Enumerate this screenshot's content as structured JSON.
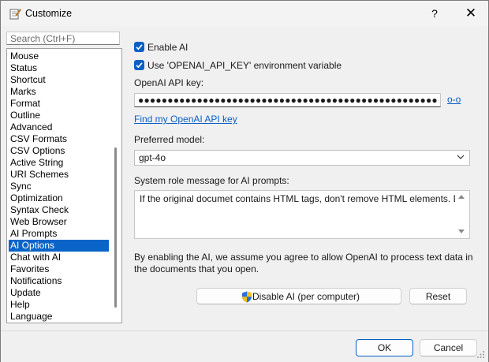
{
  "window": {
    "title": "Customize",
    "help_label": "?",
    "close_label": "✕"
  },
  "sidebar": {
    "search_placeholder": "Search (Ctrl+F)",
    "items": [
      {
        "label": "Mouse"
      },
      {
        "label": "Status"
      },
      {
        "label": "Shortcut"
      },
      {
        "label": "Marks"
      },
      {
        "label": "Format"
      },
      {
        "label": "Outline"
      },
      {
        "label": "Advanced"
      },
      {
        "label": "CSV Formats"
      },
      {
        "label": "CSV Options"
      },
      {
        "label": "Active String"
      },
      {
        "label": "URI Schemes"
      },
      {
        "label": "Sync"
      },
      {
        "label": "Optimization"
      },
      {
        "label": "Syntax Check"
      },
      {
        "label": "Web Browser"
      },
      {
        "label": "AI Prompts"
      },
      {
        "label": "AI Options",
        "selected": true
      },
      {
        "label": "Chat with AI"
      },
      {
        "label": "Favorites"
      },
      {
        "label": "Notifications"
      },
      {
        "label": "Update"
      },
      {
        "label": "Help"
      },
      {
        "label": "Language"
      }
    ]
  },
  "ai_options": {
    "enable_ai_label": "Enable AI",
    "enable_ai_checked": true,
    "use_env_label": "Use 'OPENAI_API_KEY' environment variable",
    "use_env_checked": true,
    "api_key_label": "OpenAI API key:",
    "api_key_value": "●●●●●●●●●●●●●●●●●●●●●●●●●●●●●●●●●●●●●●●●●●●●●●●●●●●",
    "show_key_link": "o-o",
    "find_key_link": "Find my OpenAI API key",
    "model_label": "Preferred model:",
    "model_value": "gpt-4o",
    "system_message_label": "System role message for AI prompts:",
    "system_message_value": "If the original documet contains HTML tags, don't remove HTML elements. Do",
    "consent_note": "By enabling the AI, we assume you agree to allow OpenAI to process text data in the documents that you open.",
    "disable_button": "Disable AI (per computer)",
    "reset_button": "Reset"
  },
  "footer": {
    "ok_button": "OK",
    "cancel_button": "Cancel"
  },
  "colors": {
    "accent": "#0a5fc4",
    "selection": "#0a64c8",
    "link": "#0a5fc4"
  }
}
